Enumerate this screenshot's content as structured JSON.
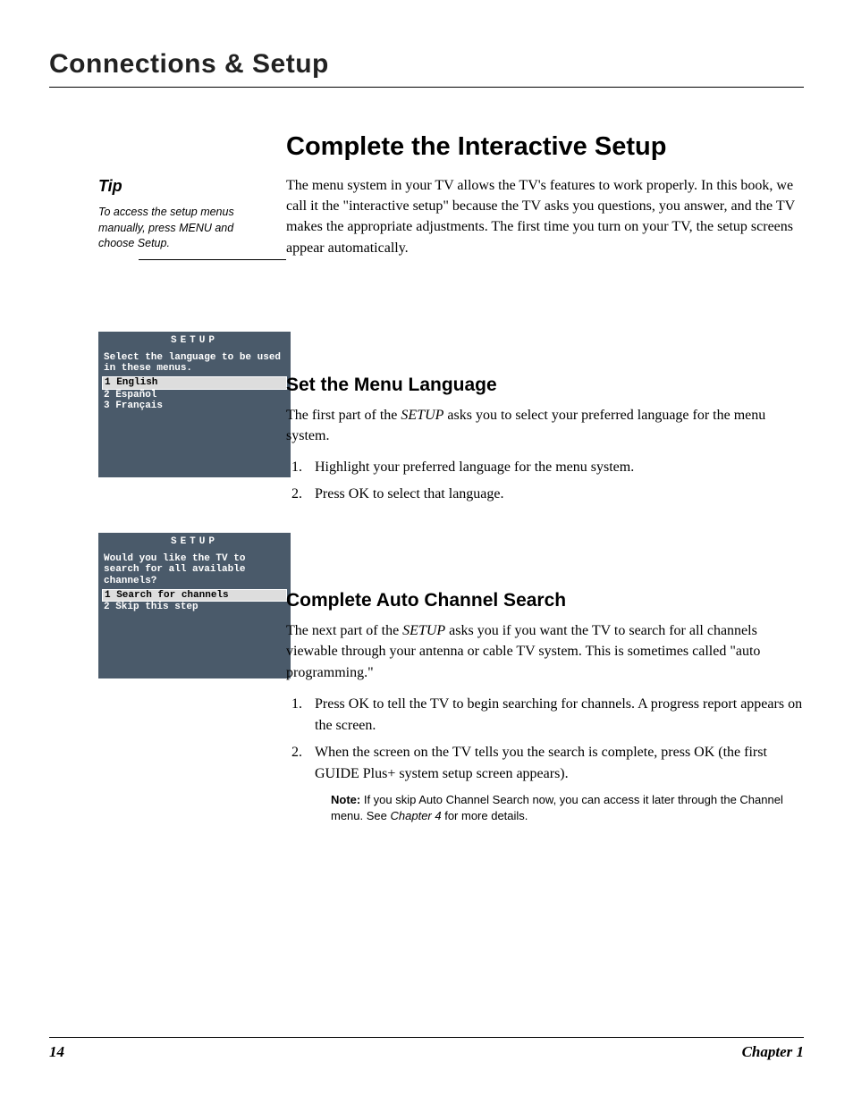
{
  "header": {
    "chapter_title": "Connections & Setup"
  },
  "tip": {
    "heading": "Tip",
    "text": "To access the setup menus manually, press MENU and choose Setup."
  },
  "screen1": {
    "title": "SETUP",
    "prompt": "Select the language to be used in these menus.",
    "opt1": "1 English",
    "opt2": "2 Español",
    "opt3": "3 Français"
  },
  "screen2": {
    "title": "SETUP",
    "prompt": "Would you like the TV to search for all available channels?",
    "opt1": "1 Search for channels",
    "opt2": "2 Skip this step"
  },
  "main": {
    "title": "Complete the Interactive Setup",
    "intro": "The menu system in your TV allows the TV's features to work properly. In this book, we call it the \"interactive setup\" because the TV asks you questions, you answer, and the TV makes the appropriate adjustments. The first time you turn on your TV, the setup screens appear automatically."
  },
  "lang": {
    "title": "Set the Menu Language",
    "p_pre": "The first part of the ",
    "p_setup": "SETUP",
    "p_post": " asks you to select your preferred language for the menu system.",
    "step1": "Highlight your preferred language for the menu system.",
    "step2": "Press OK to select that language."
  },
  "auto": {
    "title": "Complete Auto Channel Search",
    "p_pre": "The next part of the ",
    "p_setup": "SETUP",
    "p_post": " asks you if you want the TV to search for all channels viewable through your antenna or cable TV system. This is sometimes called \"auto programming.\"",
    "step1": "Press OK to tell the TV to begin searching for channels. A progress report appears on the screen.",
    "step2": "When the screen on the TV tells you the search is complete, press OK (the first GUIDE Plus+ system setup screen appears).",
    "note_label": "Note:",
    "note_pre": "  If you skip Auto Channel Search now, you can access it later through the Channel menu. See ",
    "note_ref": "Chapter 4",
    "note_post": " for more details."
  },
  "footer": {
    "page": "14",
    "chapter": "Chapter 1"
  }
}
